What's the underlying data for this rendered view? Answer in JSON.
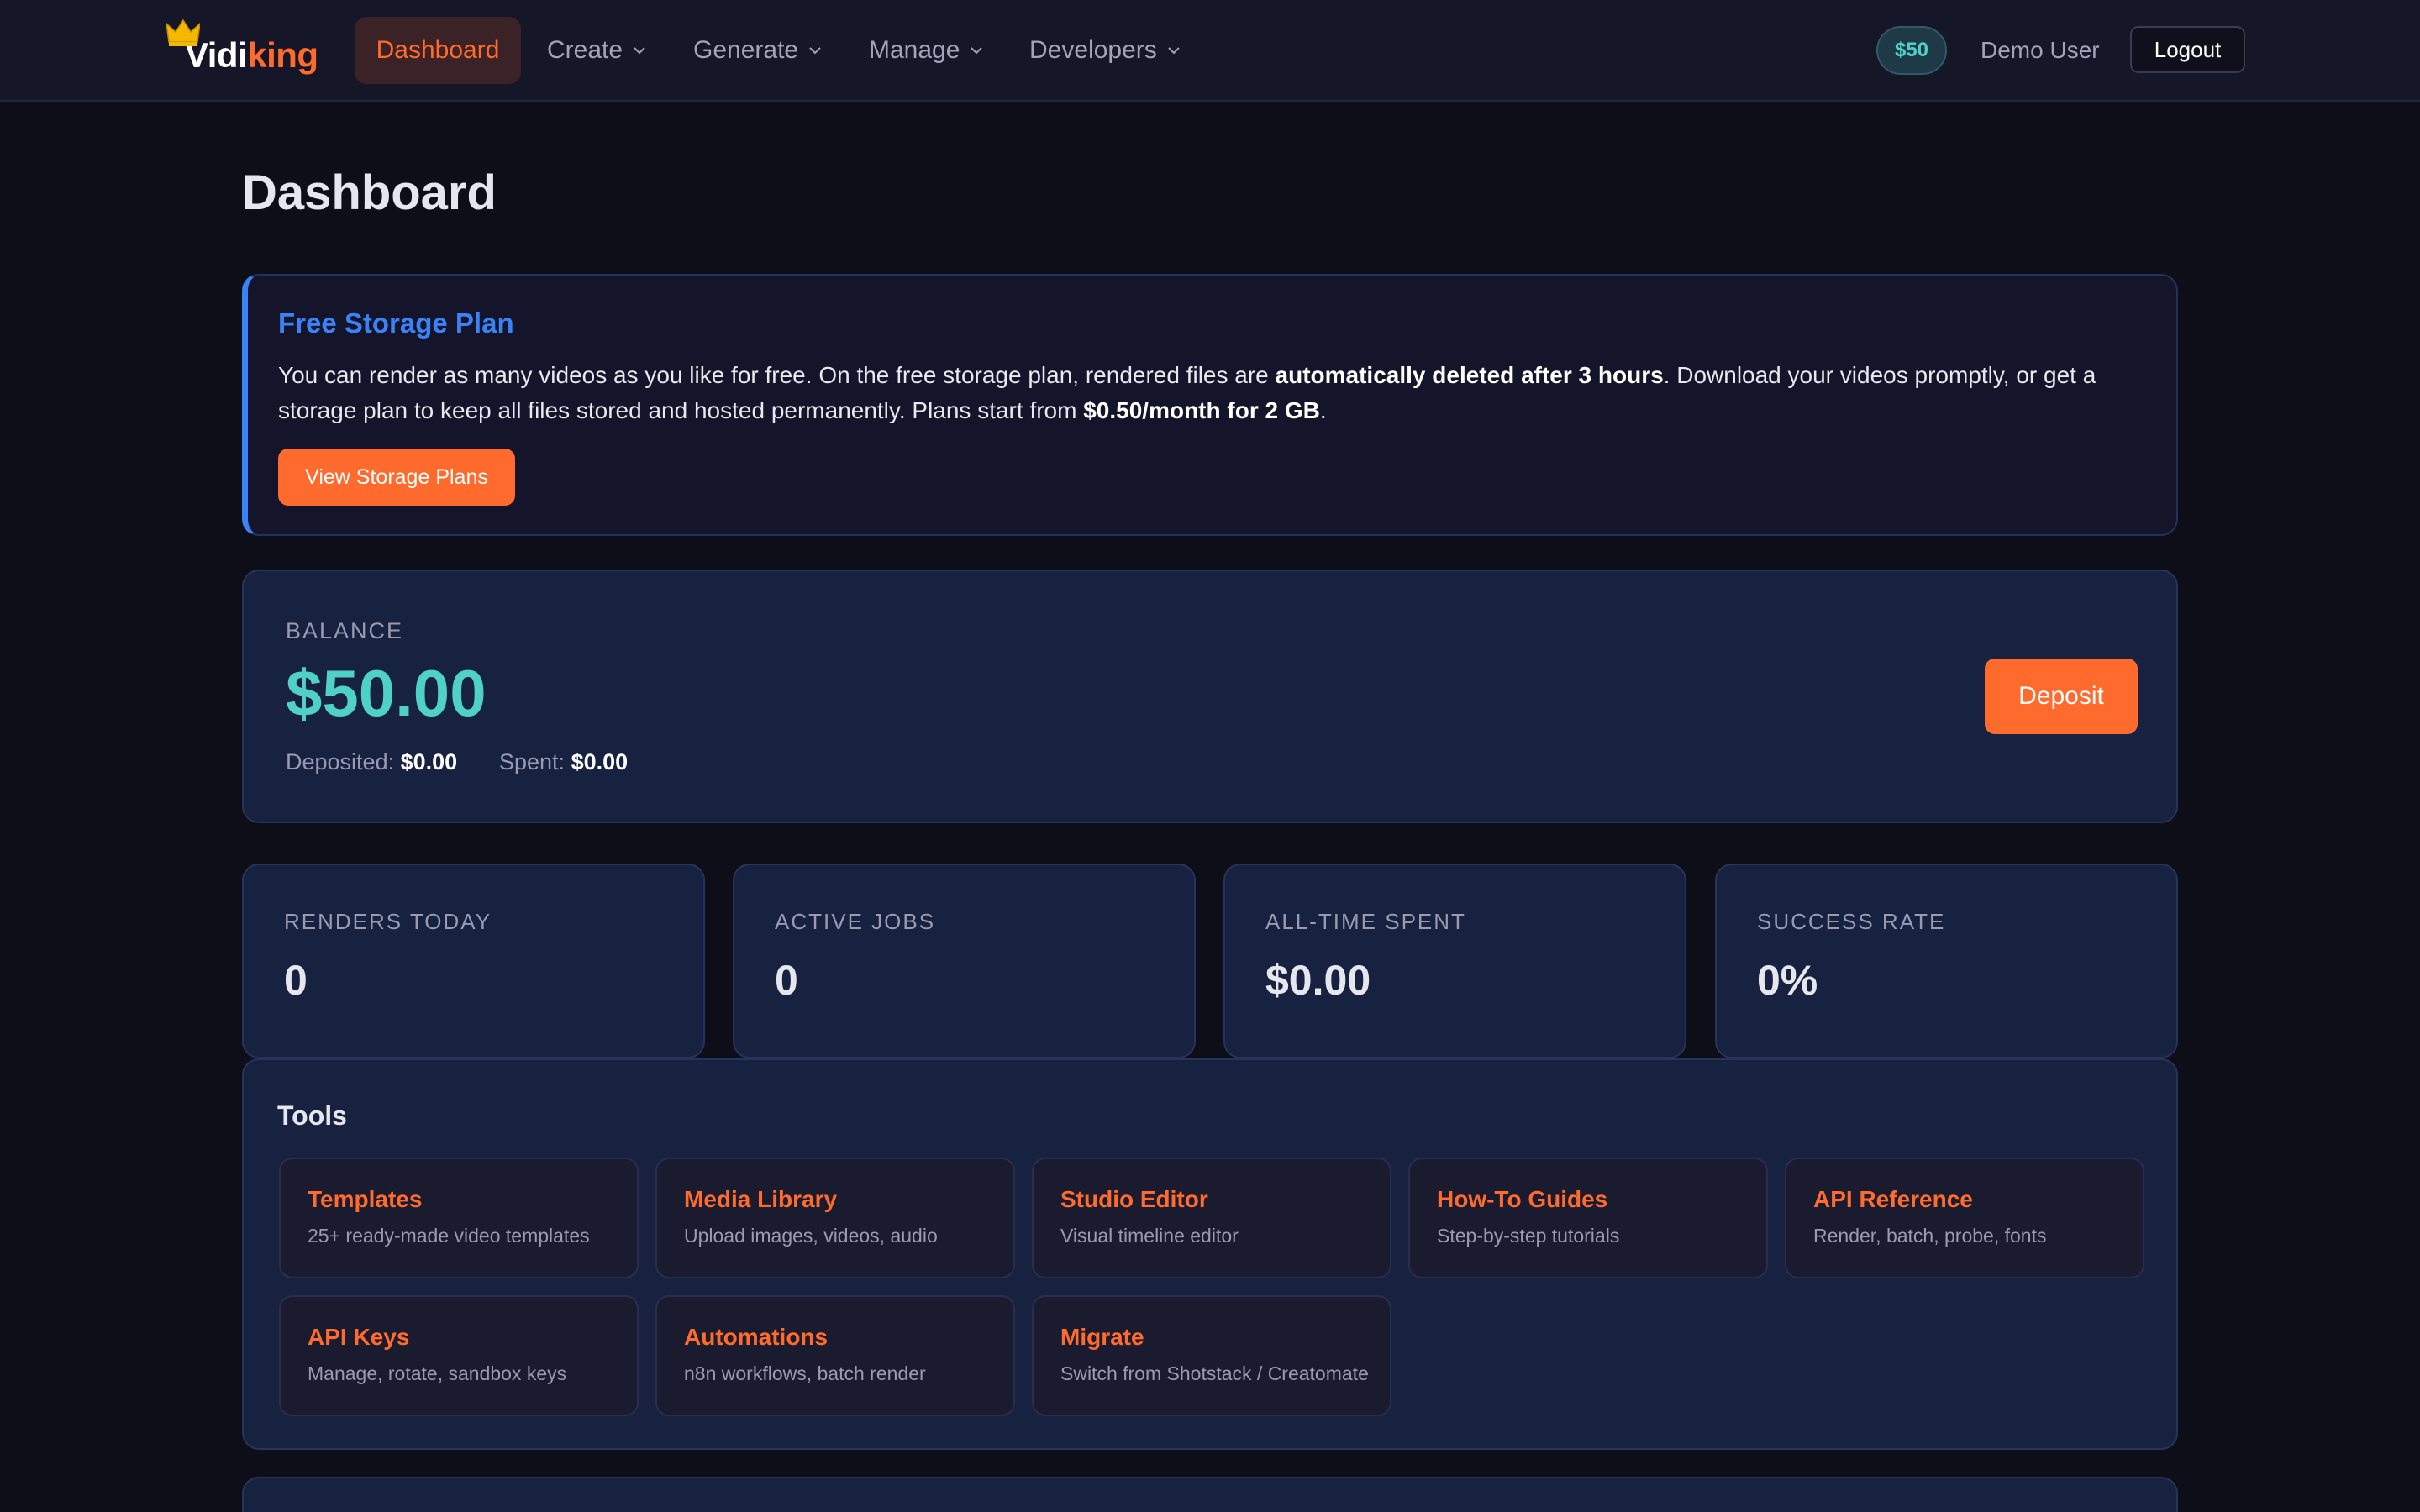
{
  "navbar": {
    "brand_part1": "Vidi",
    "brand_part2": "king",
    "items": [
      {
        "label": "Dashboard"
      },
      {
        "label": "Create"
      },
      {
        "label": "Generate"
      },
      {
        "label": "Manage"
      },
      {
        "label": "Developers"
      }
    ],
    "balance_badge": "$50",
    "user_name": "Demo User",
    "logout_label": "Logout"
  },
  "page": {
    "title": "Dashboard"
  },
  "notice": {
    "title": "Free Storage Plan",
    "text_1": "You can render as many videos as you like for free. On the free storage plan, rendered files are ",
    "text_bold_1": "automatically deleted after 3 hours",
    "text_2": ". Download your videos promptly, or get a storage plan to keep all files stored and hosted permanently. Plans start from ",
    "text_bold_2": "$0.50/month for 2 GB",
    "text_3": ".",
    "button_label": "View Storage Plans"
  },
  "balance": {
    "label": "BALANCE",
    "amount": "$50.00",
    "deposited_label": "Deposited:",
    "deposited_value": "$0.00",
    "spent_label": "Spent:",
    "spent_value": "$0.00",
    "deposit_label": "Deposit"
  },
  "stats": [
    {
      "label": "RENDERS TODAY",
      "value": "0"
    },
    {
      "label": "ACTIVE JOBS",
      "value": "0"
    },
    {
      "label": "ALL-TIME SPENT",
      "value": "$0.00"
    },
    {
      "label": "SUCCESS RATE",
      "value": "0%"
    }
  ],
  "tools": {
    "title": "Tools",
    "items": [
      {
        "name": "Templates",
        "desc": "25+ ready-made video templates"
      },
      {
        "name": "Media Library",
        "desc": "Upload images, videos, audio"
      },
      {
        "name": "Studio Editor",
        "desc": "Visual timeline editor"
      },
      {
        "name": "How-To Guides",
        "desc": "Step-by-step tutorials"
      },
      {
        "name": "API Reference",
        "desc": "Render, batch, probe, fonts"
      },
      {
        "name": "API Keys",
        "desc": "Manage, rotate, sandbox keys"
      },
      {
        "name": "Automations",
        "desc": "n8n workflows, batch render"
      },
      {
        "name": "Migrate",
        "desc": "Switch from Shotstack / Creatomate"
      }
    ]
  },
  "colors": {
    "accent": "#ff6b2c",
    "info": "#3b82f6",
    "balance": "#4fd1c5",
    "background": "#0e0e18",
    "card": "#172240"
  }
}
